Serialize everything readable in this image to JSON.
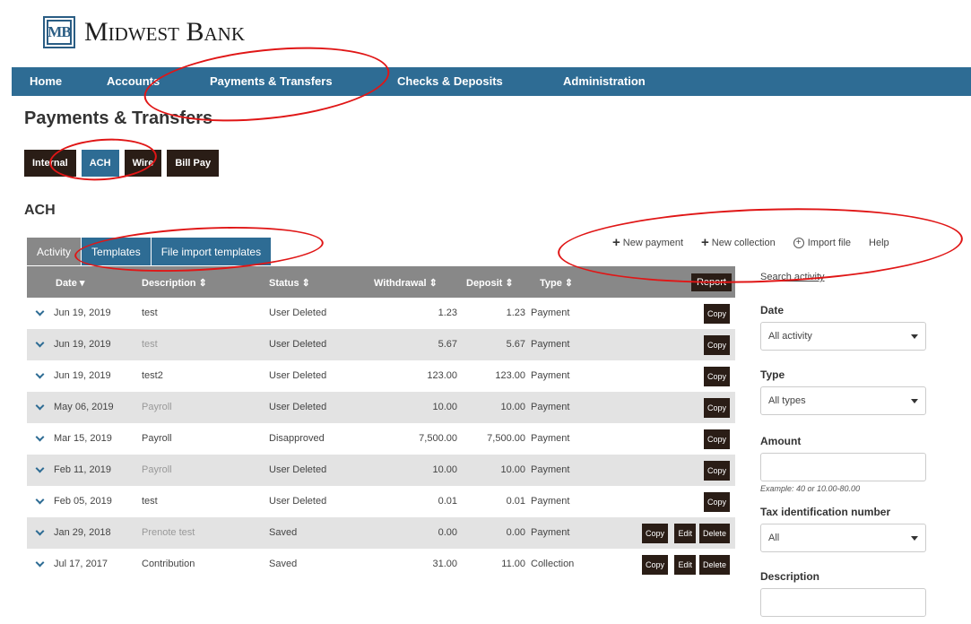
{
  "brand": {
    "logo_mark": "MB",
    "name": "Midwest Bank"
  },
  "nav": {
    "items": [
      {
        "label": "Home"
      },
      {
        "label": "Accounts"
      },
      {
        "label": "Payments & Transfers"
      },
      {
        "label": "Checks & Deposits"
      },
      {
        "label": "Administration"
      }
    ]
  },
  "page": {
    "title": "Payments & Transfers",
    "section_title": "ACH"
  },
  "subnav": {
    "items": [
      {
        "label": "Internal"
      },
      {
        "label": "ACH",
        "active": true
      },
      {
        "label": "Wire"
      },
      {
        "label": "Bill Pay"
      }
    ]
  },
  "tabs": [
    {
      "label": "Activity",
      "active": true
    },
    {
      "label": "Templates"
    },
    {
      "label": "File import templates"
    }
  ],
  "actions": {
    "new_payment": "New payment",
    "new_collection": "New collection",
    "import_file": "Import file",
    "help": "Help"
  },
  "table": {
    "headers": {
      "date": "Date",
      "description": "Description",
      "status": "Status",
      "withdrawal": "Withdrawal",
      "deposit": "Deposit",
      "type": "Type"
    },
    "report_label": "Report",
    "copy_label": "Copy",
    "edit_label": "Edit",
    "delete_label": "Delete",
    "rows": [
      {
        "date": "Jun 19, 2019",
        "description": "test",
        "status": "User Deleted",
        "withdrawal": "1.23",
        "deposit": "1.23",
        "type": "Payment"
      },
      {
        "date": "Jun 19, 2019",
        "description": "test",
        "status": "User Deleted",
        "withdrawal": "5.67",
        "deposit": "5.67",
        "type": "Payment"
      },
      {
        "date": "Jun 19, 2019",
        "description": "test2",
        "status": "User Deleted",
        "withdrawal": "123.00",
        "deposit": "123.00",
        "type": "Payment"
      },
      {
        "date": "May 06, 2019",
        "description": "Payroll",
        "status": "User Deleted",
        "withdrawal": "10.00",
        "deposit": "10.00",
        "type": "Payment"
      },
      {
        "date": "Mar 15, 2019",
        "description": "Payroll",
        "status": "Disapproved",
        "withdrawal": "7,500.00",
        "deposit": "7,500.00",
        "type": "Payment"
      },
      {
        "date": "Feb 11, 2019",
        "description": "Payroll",
        "status": "User Deleted",
        "withdrawal": "10.00",
        "deposit": "10.00",
        "type": "Payment"
      },
      {
        "date": "Feb 05, 2019",
        "description": "test",
        "status": "User Deleted",
        "withdrawal": "0.01",
        "deposit": "0.01",
        "type": "Payment"
      },
      {
        "date": "Jan 29, 2018",
        "description": "Prenote test",
        "status": "Saved",
        "withdrawal": "0.00",
        "deposit": "0.00",
        "type": "Payment"
      },
      {
        "date": "Jul 17, 2017",
        "description": "Contribution",
        "status": "Saved",
        "withdrawal": "31.00",
        "deposit": "11.00",
        "type": "Collection"
      }
    ]
  },
  "filters": {
    "search_link": "Search activity",
    "date_label": "Date",
    "date_value": "All activity",
    "type_label": "Type",
    "type_value": "All types",
    "amount_label": "Amount",
    "amount_hint": "Example: 40 or 10.00-80.00",
    "tin_label": "Tax identification number",
    "tin_value": "All",
    "description_label": "Description"
  },
  "colors": {
    "nav_blue": "#2e6c94",
    "dark_button": "#2a1d16",
    "annotation_red": "#e01616"
  }
}
